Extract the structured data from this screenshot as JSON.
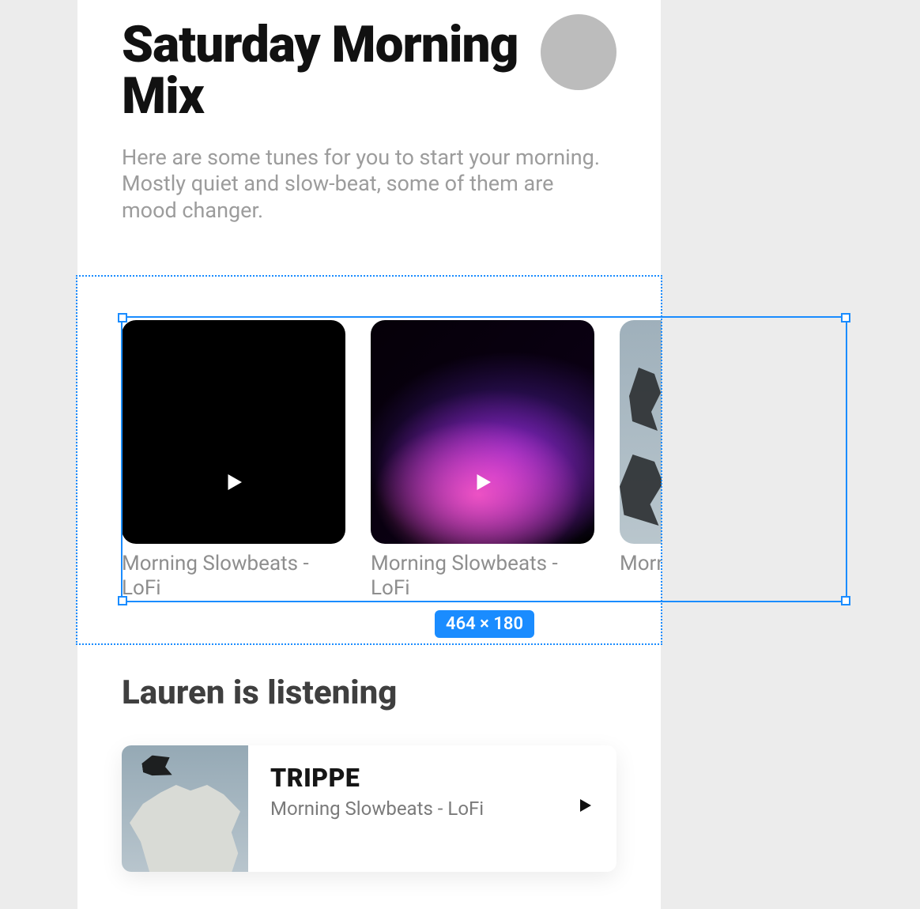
{
  "header": {
    "title": "Saturday Morning Mix",
    "subtitle": "Here are some tunes for you to start your morning. Mostly quiet and slow-beat, some of them are mood changer."
  },
  "carousel": {
    "items": [
      {
        "label": "Morning Slowbeats - LoFi"
      },
      {
        "label": "Morning Slowbeats - LoFi"
      },
      {
        "label": "Morning Slowbeats - LoFi"
      }
    ]
  },
  "inspector": {
    "dimensions": "464 × 180"
  },
  "section2": {
    "title": "Lauren is listening"
  },
  "now_playing": {
    "title": "TRIPPE",
    "subtitle": "Morning Slowbeats - LoFi"
  }
}
